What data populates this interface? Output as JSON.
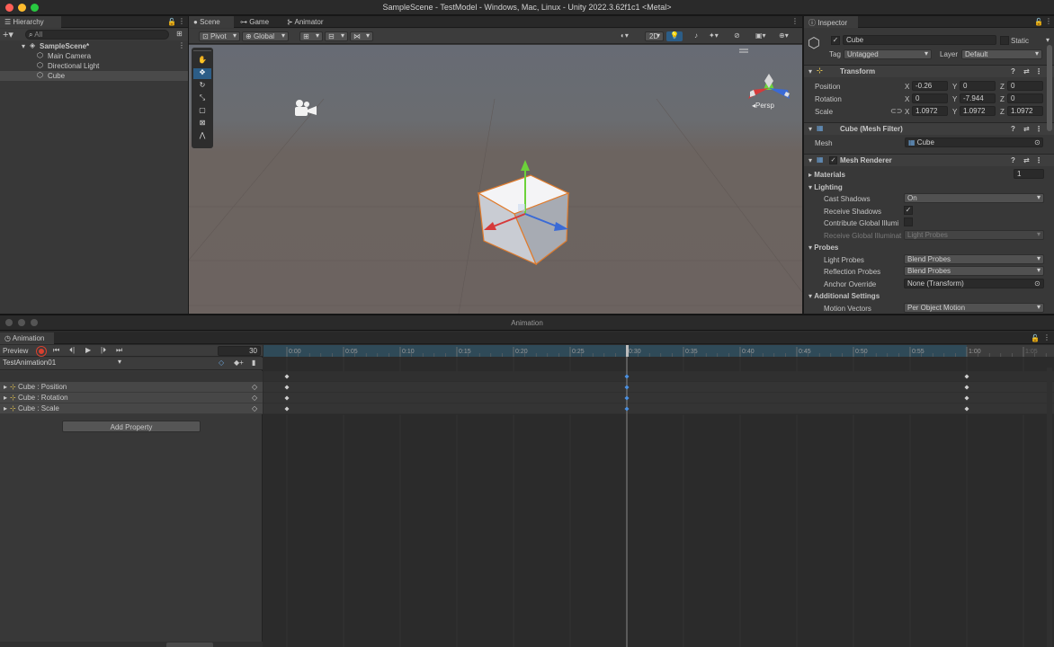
{
  "window": {
    "title": "SampleScene - TestModel - Windows, Mac, Linux - Unity 2022.3.62f1c1 <Metal>",
    "dot_colors": [
      "#fe5f57",
      "#febc2e",
      "#28c840"
    ]
  },
  "hierarchy": {
    "tab": "Hierarchy",
    "search_placeholder": "All",
    "scene": "SampleScene*",
    "items": [
      "Main Camera",
      "Directional Light",
      "Cube"
    ],
    "selected": "Cube"
  },
  "scene_view": {
    "tabs": [
      "Scene",
      "Game",
      "Animator"
    ],
    "pivot": "Pivot",
    "global": "Global",
    "mode_2d": "2D",
    "persp": "Persp"
  },
  "inspector": {
    "tab": "Inspector",
    "name": "Cube",
    "static": "Static",
    "tag_label": "Tag",
    "tag": "Untagged",
    "layer_label": "Layer",
    "layer": "Default",
    "transform": {
      "title": "Transform",
      "position_label": "Position",
      "rotation_label": "Rotation",
      "scale_label": "Scale",
      "position": {
        "x": "-0.26",
        "y": "0",
        "z": "0"
      },
      "rotation": {
        "x": "0",
        "y": "-7.944",
        "z": "0"
      },
      "scale": {
        "x": "1.0972",
        "y": "1.0972",
        "z": "1.0972"
      }
    },
    "mesh_filter": {
      "title": "Cube (Mesh Filter)",
      "mesh_label": "Mesh",
      "mesh": "Cube"
    },
    "mesh_renderer": {
      "title": "Mesh Renderer",
      "materials": "Materials",
      "materials_count": "1",
      "lighting": "Lighting",
      "cast_shadows_label": "Cast Shadows",
      "cast_shadows": "On",
      "receive_shadows_label": "Receive Shadows",
      "contribute_gi_label": "Contribute Global Illumi",
      "receive_gi_label": "Receive Global Illuminat",
      "receive_gi": "Light Probes",
      "probes": "Probes",
      "light_probes_label": "Light Probes",
      "light_probes": "Blend Probes",
      "reflection_probes_label": "Reflection Probes",
      "reflection_probes": "Blend Probes",
      "anchor_override_label": "Anchor Override",
      "anchor_override": "None (Transform)",
      "additional_settings": "Additional Settings",
      "motion_vectors_label": "Motion Vectors",
      "motion_vectors": "Per Object Motion"
    }
  },
  "animation": {
    "window_title": "Animation",
    "tab": "Animation",
    "preview": "Preview",
    "frame": "30",
    "clip": "TestAnimation01",
    "properties": [
      "Cube : Position",
      "Cube : Rotation",
      "Cube : Scale"
    ],
    "add_property": "Add Property",
    "timeline_labels": [
      "0:00",
      "0:05",
      "0:10",
      "0:15",
      "0:20",
      "0:25",
      "0:30",
      "0:35",
      "0:40",
      "0:45",
      "0:50",
      "0:55",
      "1:00",
      "1:05"
    ],
    "keyframes_at": [
      "0:00",
      "0:30",
      "1:00"
    ],
    "playhead": "0:30"
  }
}
